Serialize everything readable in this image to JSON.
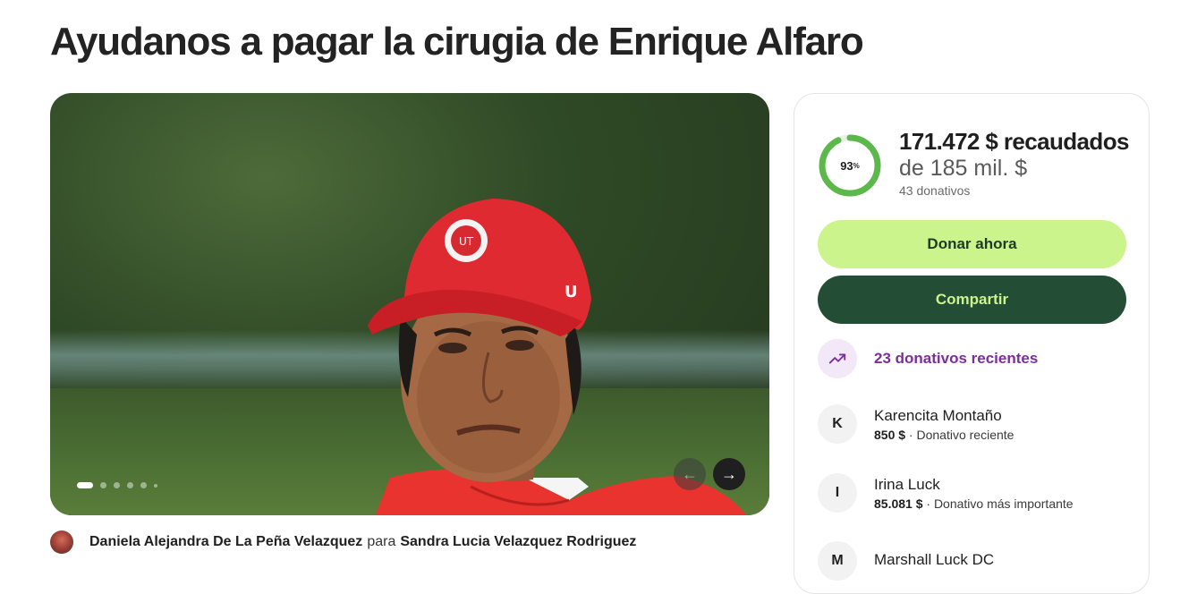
{
  "campaign": {
    "title": "Ayudanos a pagar la cirugia de Enrique Alfaro",
    "organizer_name": "Daniela Alejandra De La Peña Velazquez",
    "connector": "para",
    "beneficiary_name": "Sandra Lucia Velazquez Rodriguez"
  },
  "gallery": {
    "total_slides": 6,
    "active_slide": 1,
    "prev_icon": "arrow-left-icon",
    "next_icon": "arrow-right-icon"
  },
  "progress": {
    "percent_value": 93,
    "percent_number": "93",
    "percent_sign": "%",
    "raised_text": "171.472 $ recaudados",
    "goal_text": "de 185 mil. $",
    "donations_count_text": "43 donativos",
    "ring_color": "#5cb84a"
  },
  "actions": {
    "donate_label": "Donar ahora",
    "share_label": "Compartir"
  },
  "recent": {
    "icon": "trending-up-icon",
    "label": "23 donativos recientes"
  },
  "donors": [
    {
      "initial": "K",
      "name": "Karencita Montaño",
      "amount": "850 $",
      "note": " · Donativo reciente"
    },
    {
      "initial": "I",
      "name": "Irina Luck",
      "amount": "85.081 $",
      "note": " · Donativo más importante"
    },
    {
      "initial": "M",
      "name": "Marshall Luck DC",
      "amount": "",
      "note": ""
    }
  ],
  "colors": {
    "donate_bg": "#cbf48d",
    "share_bg": "#234d34",
    "recent_text": "#7b2f98"
  }
}
